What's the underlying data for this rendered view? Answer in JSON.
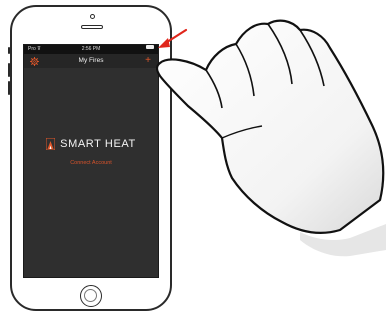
{
  "status_bar": {
    "carrier": "Pro ⊽",
    "time": "2:56 PM",
    "battery_icon": "battery-icon"
  },
  "nav": {
    "title": "My Fires",
    "settings_icon": "gear-icon",
    "add_icon": "plus-icon",
    "add_symbol": "+"
  },
  "brand": {
    "name": "SMART HEAT",
    "logo_icon": "flame-logo-icon"
  },
  "connect_label": "Connect Account",
  "colors": {
    "accent": "#e2572a",
    "screen_bg": "#2f2f2f",
    "arrow": "#e0261b"
  }
}
